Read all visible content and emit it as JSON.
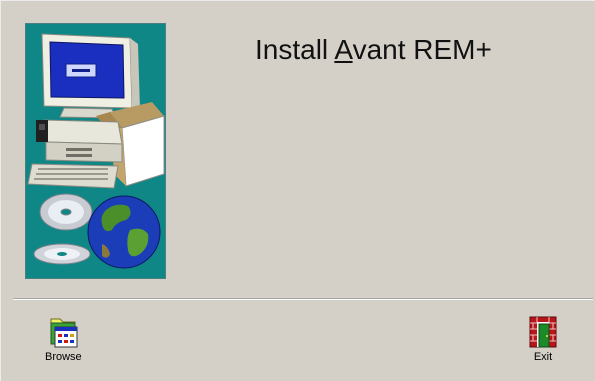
{
  "dialog": {
    "install_prefix": "Install ",
    "install_accel": "A",
    "install_suffix": "vant REM+"
  },
  "toolbar": {
    "browse_label": "Browse",
    "exit_label": "Exit"
  },
  "icons": {
    "browse": "folder-grid-icon",
    "exit": "exit-door-icon",
    "artwork": "computer-cds-globe-illustration"
  },
  "colors": {
    "dialog_bg": "#d4d0c8",
    "art_bg": "#0f8787",
    "screen_blue": "#1a2fbf"
  }
}
